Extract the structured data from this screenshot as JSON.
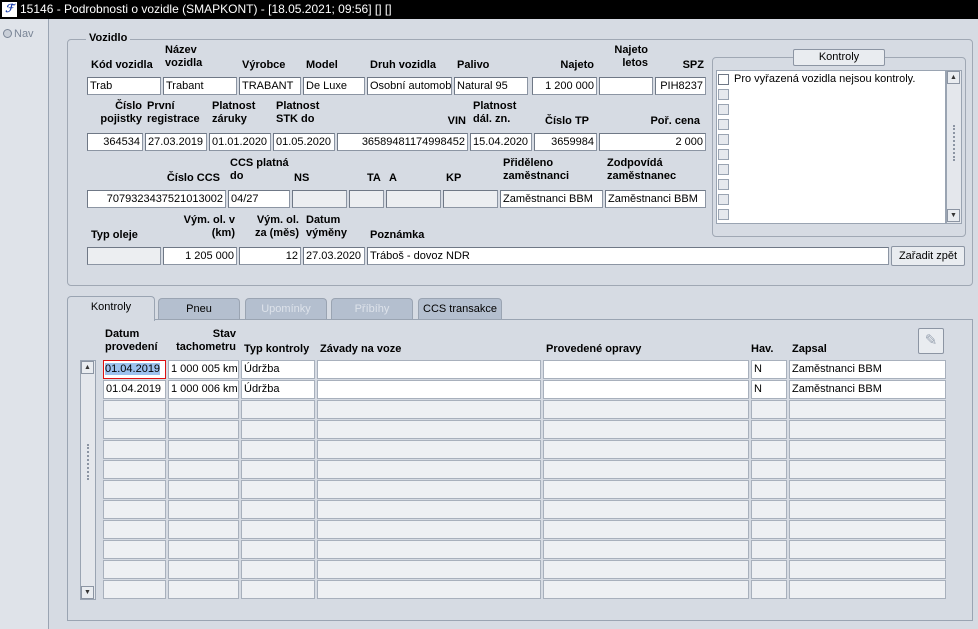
{
  "window": {
    "title": "15146 - Podrobnosti o vozidle (SMAPKONT) - [18.05.2021; 09:56] [] []",
    "logo_text": "ℱ"
  },
  "nav": {
    "label": "Nav"
  },
  "vehicle": {
    "legend": "Vozidlo",
    "labels": {
      "kod": "Kód vozidla",
      "nazev": "Název vozidla",
      "vyrobce": "Výrobce",
      "model": "Model",
      "druh": "Druh vozidla",
      "palivo": "Palivo",
      "najeto": "Najeto",
      "najeto_letos": "Najeto letos",
      "spz": "SPZ",
      "cislo_pojistky": "Číslo pojistky",
      "prvni_registrace": "První registrace",
      "platnost_zaruky": "Platnost záruky",
      "platnost_stk": "Platnost STK do",
      "vin": "VIN",
      "platnost_dal": "Platnost dál. zn.",
      "cislo_tp": "Číslo TP",
      "por_cena": "Poř. cena",
      "cislo_ccs": "Číslo CCS",
      "ccs_platna": "CCS platná do",
      "ns": "NS",
      "ta": "TA",
      "a": "A",
      "kp": "KP",
      "prideleno": "Přiděleno zaměstnanci",
      "zodpovida": "Zodpovídá zaměstnanec",
      "typ_oleje": "Typ oleje",
      "vym_ol_km": "Vým. ol. v (km)",
      "vym_ol_mes": "Vým. ol. za (měs)",
      "datum_vymeny": "Datum výměny",
      "poznamka": "Poznámka"
    },
    "values": {
      "kod": "Trab",
      "nazev": "Trabant",
      "vyrobce": "TRABANT",
      "model": "De Luxe",
      "druh": "Osobní automobil",
      "palivo": "Natural 95",
      "najeto": "1 200 000",
      "najeto_letos": "",
      "spz": "PIH8237",
      "cislo_pojistky": "364534",
      "prvni_registrace": "27.03.2019",
      "platnost_zaruky": "01.01.2020",
      "platnost_stk": "01.05.2020",
      "vin": "36589481174998452",
      "platnost_dal": "15.04.2020",
      "cislo_tp": "3659984",
      "por_cena": "2 000",
      "cislo_ccs": "7079323437521013002",
      "ccs_platna": "04/27",
      "ns": "",
      "ta": "",
      "a": "",
      "kp": "",
      "prideleno": "Zaměstnanci BBM",
      "zodpovida": "Zaměstnanci BBM",
      "typ_oleje": "",
      "vym_ol_km": "1 205 000",
      "vym_ol_mes": "12",
      "datum_vymeny": "27.03.2020",
      "poznamka": "Tráboš - dovoz NDR"
    },
    "zaradit_button": "Zařadit zpět"
  },
  "kontroly_panel": {
    "button": "Kontroly",
    "message": "Pro vyřazená vozidla nejsou kontroly."
  },
  "tabs": [
    {
      "label": "Kontroly",
      "state": "active"
    },
    {
      "label": "Pneu",
      "state": "enabled"
    },
    {
      "label": "Upomínky",
      "state": "disabled"
    },
    {
      "label": "Příbíhy",
      "state": "disabled"
    },
    {
      "label": "CCS transakce",
      "state": "enabled"
    }
  ],
  "grid": {
    "columns": {
      "datum": "Datum provedení",
      "stav": "Stav tachometru",
      "typ": "Typ kontroly",
      "zavady": "Závady na voze",
      "opravy": "Provedené opravy",
      "hav": "Hav.",
      "zapsal": "Zapsal"
    },
    "rows": [
      {
        "datum": "01.04.2019",
        "stav": "1 000 005 km",
        "typ": "Údržba",
        "zavady": "",
        "opravy": "",
        "hav": "N",
        "zapsal": "Zaměstnanci BBM"
      },
      {
        "datum": "01.04.2019",
        "stav": "1 000 006 km",
        "typ": "Údržba",
        "zavady": "",
        "opravy": "",
        "hav": "N",
        "zapsal": "Zaměstnanci BBM"
      }
    ],
    "empty_rows": 10,
    "edit_icon": "edit-icon"
  }
}
